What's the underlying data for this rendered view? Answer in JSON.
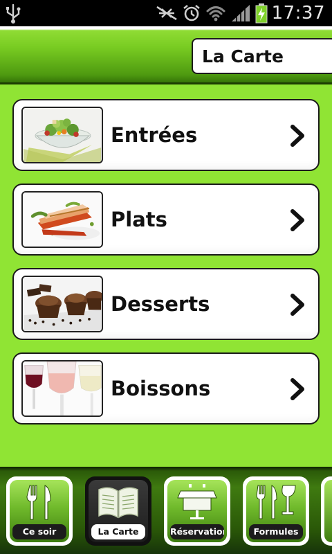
{
  "status_bar": {
    "time": "17:37",
    "icons": [
      "usb-icon",
      "no-signal-icon",
      "alarm-icon",
      "wifi-icon",
      "cell-signal-icon",
      "battery-charging-icon"
    ]
  },
  "header": {
    "title": "La Carte"
  },
  "menu": {
    "items": [
      {
        "label": "Entrées",
        "icon": "salad-thumbnail"
      },
      {
        "label": "Plats",
        "icon": "fish-dish-thumbnail"
      },
      {
        "label": "Desserts",
        "icon": "muffins-thumbnail"
      },
      {
        "label": "Boissons",
        "icon": "wine-glasses-thumbnail"
      }
    ],
    "arrow_icon": "chevron-right-icon"
  },
  "tabs": [
    {
      "label": "Ce soir",
      "icon": "fork-knife-icon",
      "active": false
    },
    {
      "label": "La Carte",
      "icon": "open-book-icon",
      "active": true
    },
    {
      "label": "Réservations",
      "icon": "reserved-table-icon",
      "active": false
    },
    {
      "label": "Formules",
      "icon": "cutlery-glass-icon",
      "active": false
    }
  ],
  "colors": {
    "background_green": "#90e434",
    "header_green": "#79cc22",
    "tab_bar_dark": "#2b5a09"
  }
}
